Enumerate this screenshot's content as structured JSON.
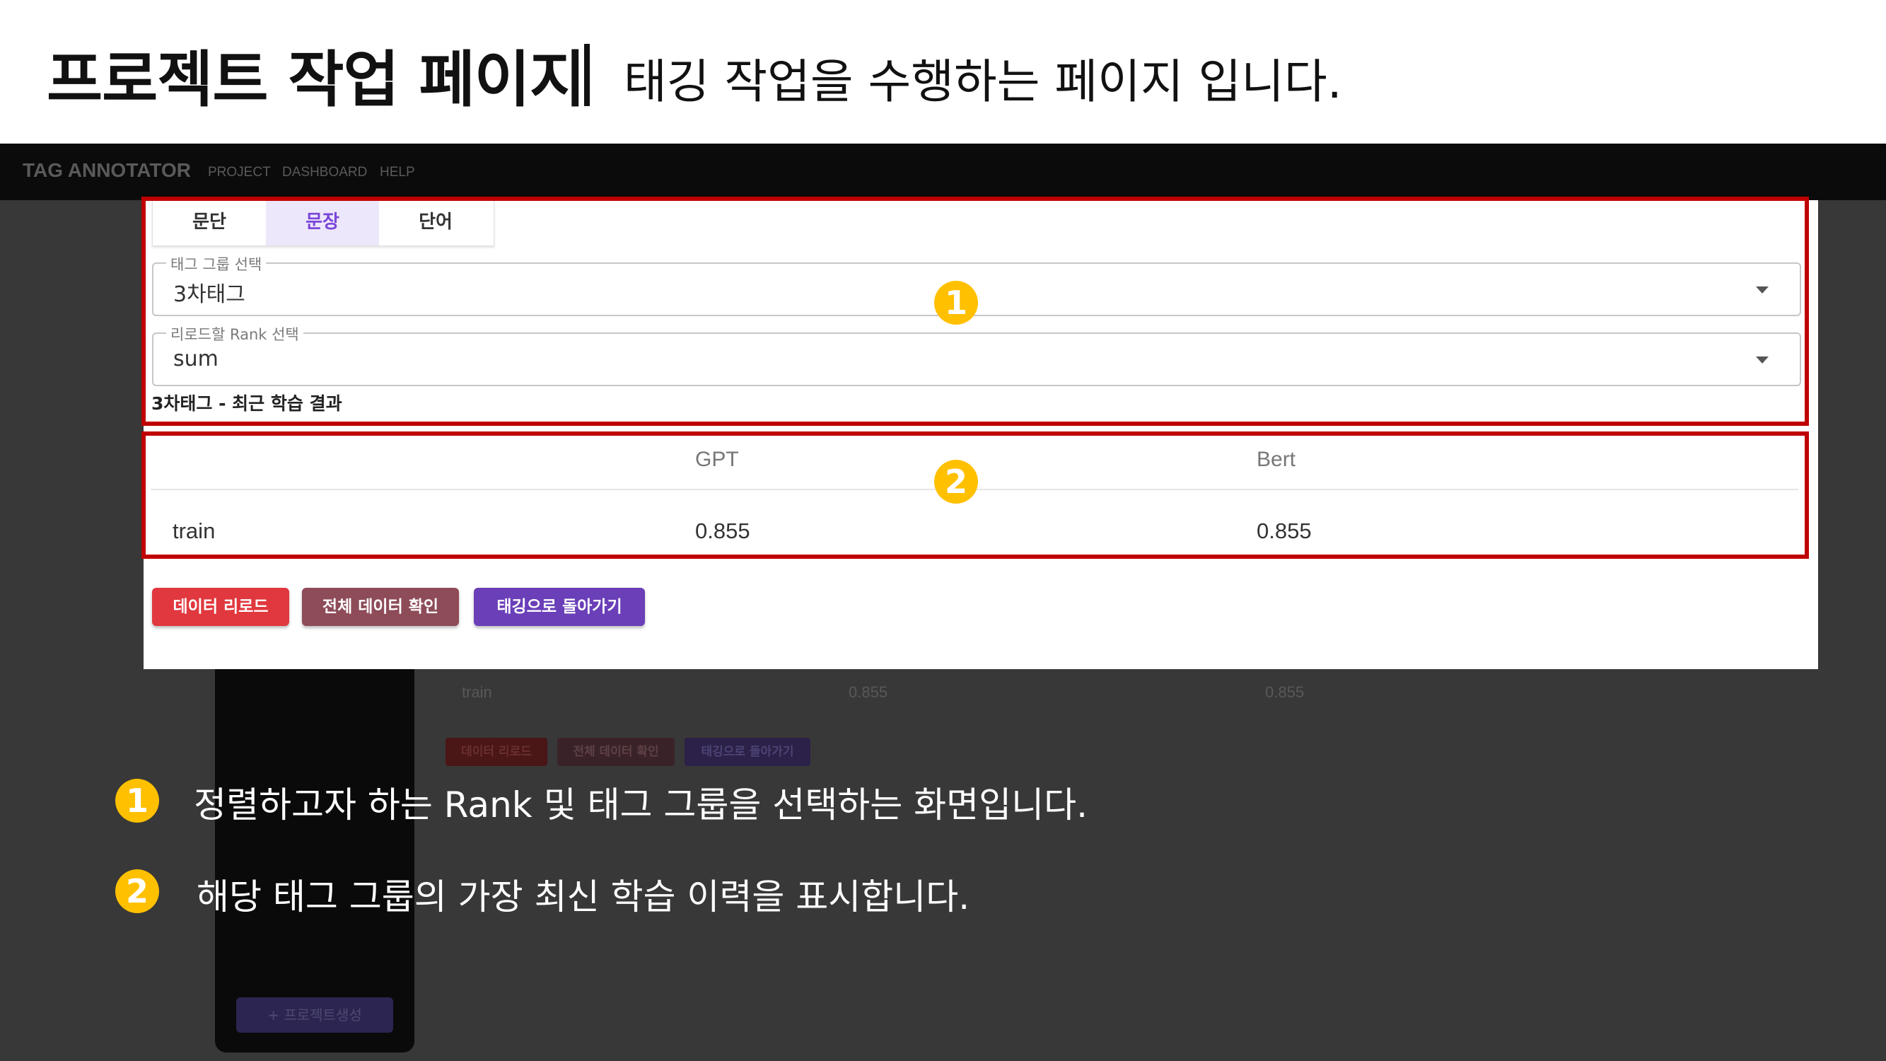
{
  "slide": {
    "title": "프로젝트 작업 페이지",
    "subtitle": "태깅 작업을 수행하는 페이지 입니다."
  },
  "app": {
    "logo": "TAG ANNOTATOR",
    "nav": [
      "PROJECT",
      "DASHBOARD",
      "HELP"
    ],
    "background": {
      "row_label": "train",
      "row_gpt": "0.855",
      "row_bert": "0.855",
      "buttons": [
        "데이터 리로드",
        "전체 데이터 확인",
        "태깅으로 돌아가기"
      ],
      "new_project": "+ 프로젝트생성"
    }
  },
  "panel": {
    "tabs": [
      {
        "label": "문단",
        "active": false
      },
      {
        "label": "문장",
        "active": true
      },
      {
        "label": "단어",
        "active": false
      }
    ],
    "tag_group": {
      "legend": "태그 그룹 선택",
      "value": "3차태그"
    },
    "rank": {
      "legend": "리로드할 Rank 선택",
      "value": "sum"
    },
    "recent_label": "3차태그 - 최근 학습 결과",
    "table": {
      "columns": [
        "",
        "GPT",
        "Bert"
      ],
      "rows": [
        [
          "train",
          "0.855",
          "0.855"
        ]
      ]
    },
    "buttons": {
      "reload": {
        "label": "데이터 리로드",
        "color": "#e0383e"
      },
      "view_all": {
        "label": "전체 데이터 확인",
        "color": "#8e4b58"
      },
      "back": {
        "label": "태깅으로 돌아가기",
        "color": "#6a3fb8"
      }
    }
  },
  "annotations": [
    {
      "badge": "1",
      "text": "정렬하고자 하는 Rank 및 태그 그룹을 선택하는 화면입니다."
    },
    {
      "badge": "2",
      "text": "해당 태그 그룹의 가장 최신 학습 이력을 표시합니다."
    }
  ],
  "colors": {
    "highlight": "#c00000",
    "badge": "#ffc000",
    "accent": "#7a45d9"
  }
}
